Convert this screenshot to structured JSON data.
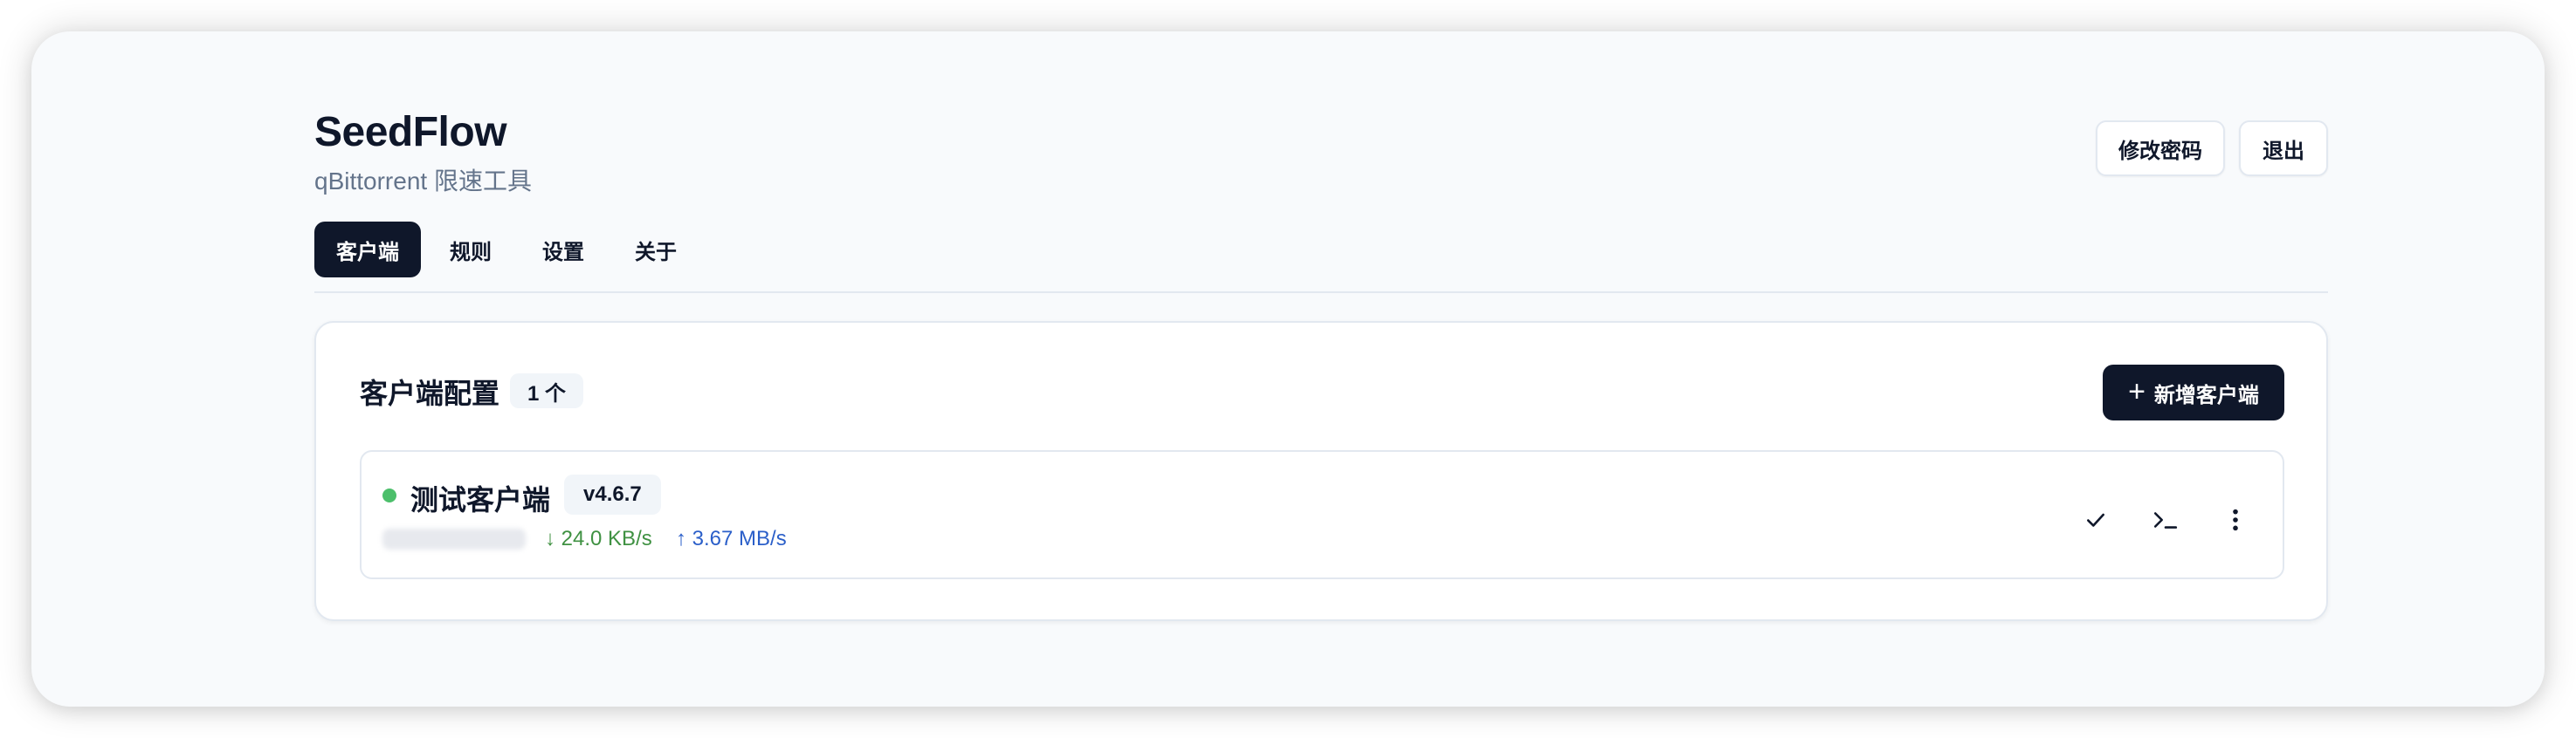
{
  "app": {
    "title": "SeedFlow",
    "subtitle": "qBittorrent 限速工具"
  },
  "header": {
    "change_password_label": "修改密码",
    "logout_label": "退出"
  },
  "tabs": [
    {
      "label": "客户端",
      "active": true
    },
    {
      "label": "规则",
      "active": false
    },
    {
      "label": "设置",
      "active": false
    },
    {
      "label": "关于",
      "active": false
    }
  ],
  "clients_panel": {
    "title": "客户端配置",
    "count_label": "1 个",
    "add_button_label": "新增客户端",
    "add_icon": "plus-icon"
  },
  "client": {
    "name": "测试客户端",
    "version": "v4.6.7",
    "status": "online",
    "status_color": "#4cbf6b",
    "download_speed": "↓ 24.0 KB/s",
    "upload_speed": "↑ 3.67 MB/s",
    "actions": [
      "check-icon",
      "terminal-icon",
      "more-vertical-icon"
    ]
  },
  "colors": {
    "primary": "#0f172a",
    "muted_text": "#64748b",
    "border": "#e2e8f0",
    "download": "#3f9142",
    "upload": "#2b5fc9"
  }
}
